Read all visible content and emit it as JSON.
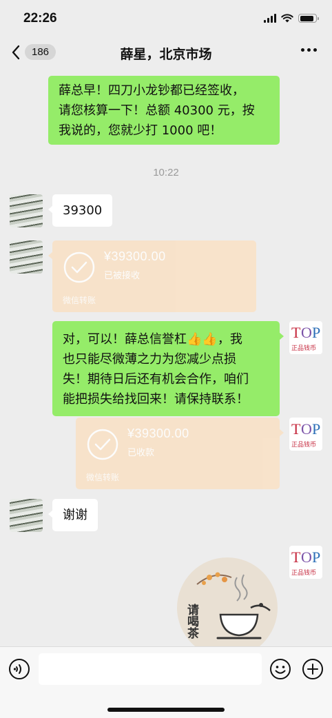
{
  "status": {
    "time": "22:26",
    "battery_level": 0.9
  },
  "nav": {
    "badge": "186",
    "title": "薛星，北京市场"
  },
  "messages": {
    "m1": {
      "line1": "薛总早！四刀小龙钞都已经签收，",
      "line2": "请您核算一下！总额 40300 元，按",
      "line3": "我说的，您就少打 1000 吧！"
    },
    "time_sep": "10:22",
    "m2": "39300",
    "transfer1": {
      "amount": "¥39300.00",
      "status": "已被接收",
      "footer": "微信转账"
    },
    "m3": {
      "line1": "对，可以！薛总信誉杠👍👍，我",
      "line2": "也只能尽微薄之力为您减少点损",
      "line3": "失！期待日后还有机会合作，咱们",
      "line4": "能把损失给找回来！请保持联系！"
    },
    "transfer2": {
      "amount": "¥39300.00",
      "status": "已收款",
      "footer": "微信转账"
    },
    "m4": "谢谢",
    "sticker": {
      "text": "请喝茶"
    }
  },
  "avatar_logo": {
    "top": "TOP",
    "bottom": "正品钱币"
  },
  "input": {
    "placeholder": ""
  },
  "colors": {
    "sent_bubble": "#95ec69",
    "received_bubble": "#ffffff",
    "transfer_bg": "#f9e1c4",
    "background": "#ededed"
  }
}
